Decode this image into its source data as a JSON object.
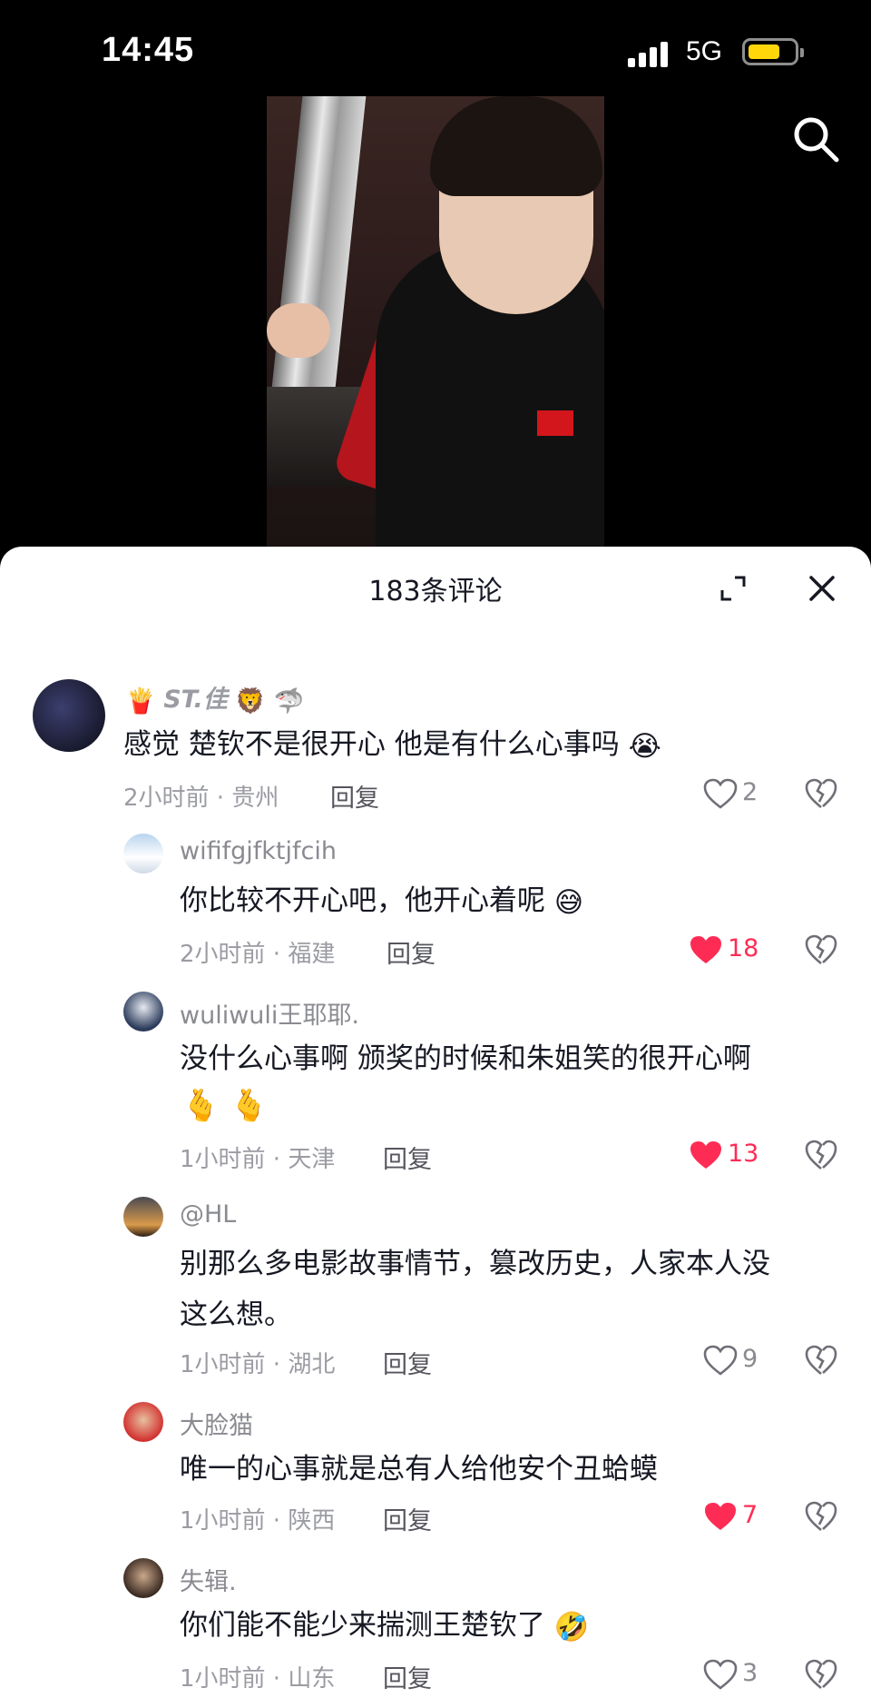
{
  "status_bar": {
    "time": "14:45",
    "network": "5G"
  },
  "sheet": {
    "title": "183条评论"
  },
  "comments": [
    {
      "user": "ST.佳",
      "text": "感觉 楚钦不是很开心 他是有什么心事吗",
      "time_location": "2小时前 · 贵州",
      "reply": "回复",
      "likes": "2",
      "liked": false
    },
    {
      "user": "wififgjfktjfcih",
      "text": "你比较不开心吧，他开心着呢",
      "time_location": "2小时前 · 福建",
      "reply": "回复",
      "likes": "18",
      "liked": true
    },
    {
      "user": "wuliwuli王耶耶.",
      "text": "没什么心事啊 颁奖的时候和朱姐笑的很开心啊",
      "time_location": "1小时前 · 天津",
      "reply": "回复",
      "likes": "13",
      "liked": true
    },
    {
      "user": "@HL",
      "text_line1": "别那么多电影故事情节，篡改历史，人家本人没",
      "text_line2": "这么想。",
      "time_location": "1小时前 · 湖北",
      "reply": "回复",
      "likes": "9",
      "liked": false
    },
    {
      "user": "大脸猫",
      "text": "唯一的心事就是总有人给他安个丑蛤蟆",
      "time_location": "1小时前 · 陕西",
      "reply": "回复",
      "likes": "7",
      "liked": true
    },
    {
      "user": "失辑.",
      "text": "你们能不能少来揣测王楚钦了",
      "time_location": "1小时前 · 山东",
      "reply": "回复",
      "likes": "3",
      "liked": false
    }
  ],
  "colors": {
    "liked": "#fe2c55",
    "battery": "#ffd60a",
    "text": "#161823",
    "secondary": "#9b9ca3"
  },
  "icons": [
    "search-icon",
    "expand-icon",
    "close-icon",
    "heart-icon",
    "broken-heart-icon",
    "signal-icon",
    "battery-icon"
  ]
}
